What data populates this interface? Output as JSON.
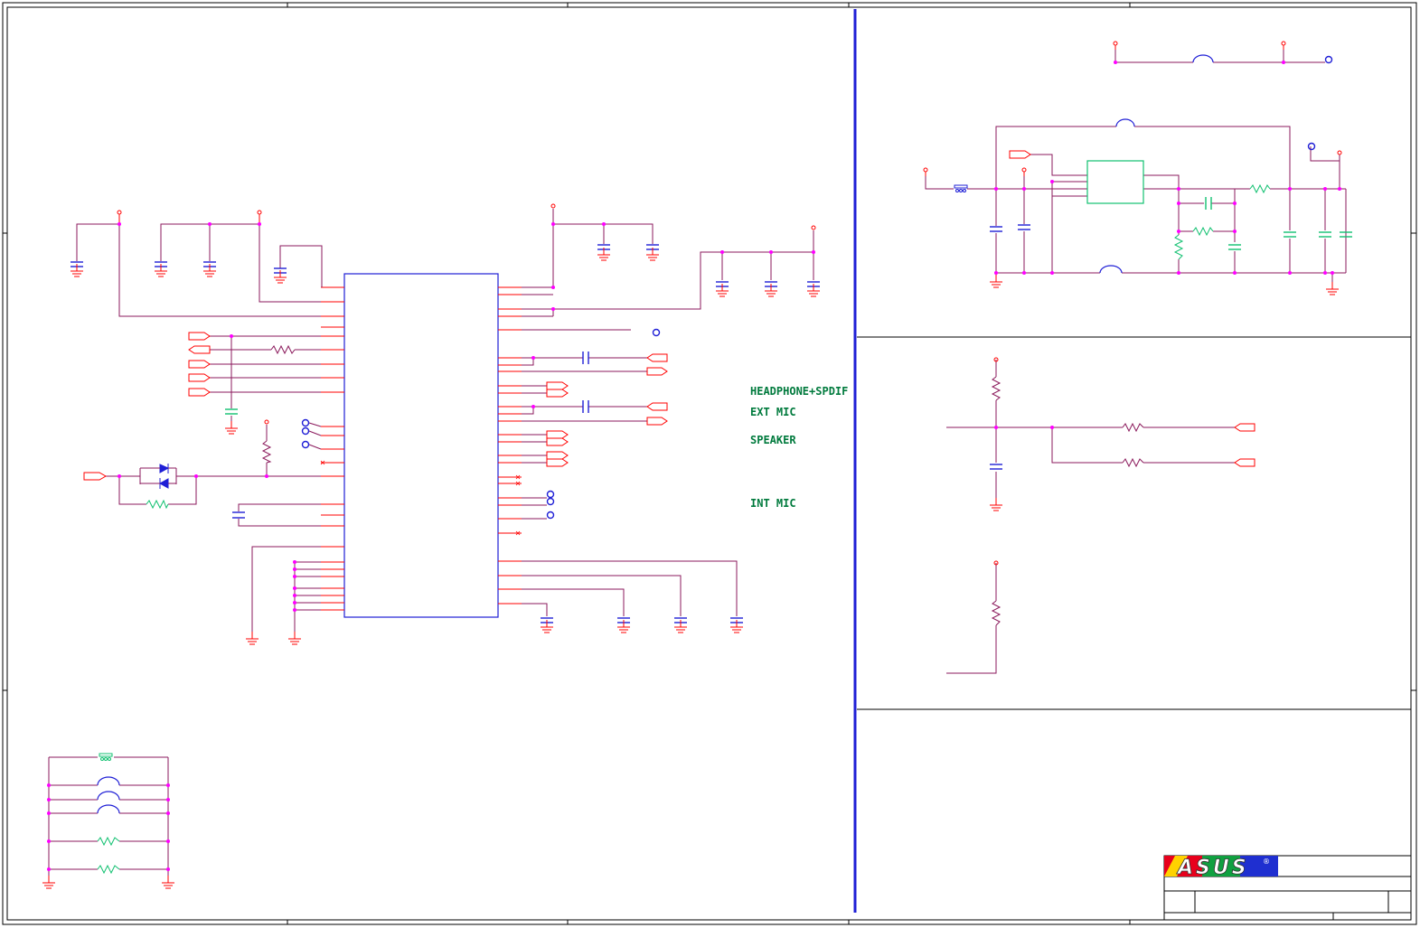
{
  "labels": {
    "headphone": "HEADPHONE+SPDIF",
    "ext_mic": "EXT MIC",
    "speaker": "SPEAKER",
    "int_mic": "INT MIC"
  },
  "title_block": {
    "logo_text": "ASUS",
    "registered_mark": "®"
  },
  "colors": {
    "wire": "#8b1a5c",
    "pin": "#ff0000",
    "part": "#1f1fd6",
    "alt_part": "#10c070",
    "label": "#007a3d",
    "node": "#ff00ff"
  }
}
